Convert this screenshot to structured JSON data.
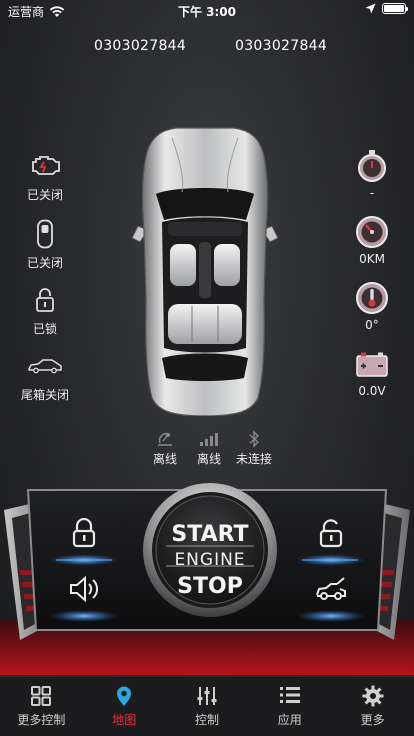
{
  "status_bar": {
    "carrier": "运营商",
    "time": "下午 3:00"
  },
  "ids": {
    "left": "0303027844",
    "right": "0303027844"
  },
  "left_stats": [
    {
      "icon": "engine-icon",
      "label": "已关闭"
    },
    {
      "icon": "door-icon",
      "label": "已关闭"
    },
    {
      "icon": "lock-icon",
      "label": "已锁"
    },
    {
      "icon": "trunk-car-icon",
      "label": "尾箱关闭"
    }
  ],
  "right_stats": [
    {
      "icon": "stopwatch-icon",
      "label": "-"
    },
    {
      "icon": "odometer-icon",
      "label": "0KM"
    },
    {
      "icon": "thermometer-icon",
      "label": "0°"
    },
    {
      "icon": "battery-icon",
      "label": "0.0V"
    }
  ],
  "connectivity": [
    {
      "icon": "satellite-icon",
      "label": "离线"
    },
    {
      "icon": "signal-icon",
      "label": "离线"
    },
    {
      "icon": "bluetooth-icon",
      "label": "未连接"
    }
  ],
  "engine_button": {
    "line1": "START",
    "line2": "ENGINE",
    "line3": "STOP"
  },
  "tabs": [
    {
      "icon": "grid-icon",
      "label": "更多控制",
      "active": false
    },
    {
      "icon": "map-pin-icon",
      "label": "地图",
      "active": true
    },
    {
      "icon": "sliders-icon",
      "label": "控制",
      "active": false
    },
    {
      "icon": "list-icon",
      "label": "应用",
      "active": false
    },
    {
      "icon": "gear-icon",
      "label": "更多",
      "active": false
    }
  ],
  "colors": {
    "accent": "#e2343e",
    "icon_glow": "#3aa0ff"
  }
}
